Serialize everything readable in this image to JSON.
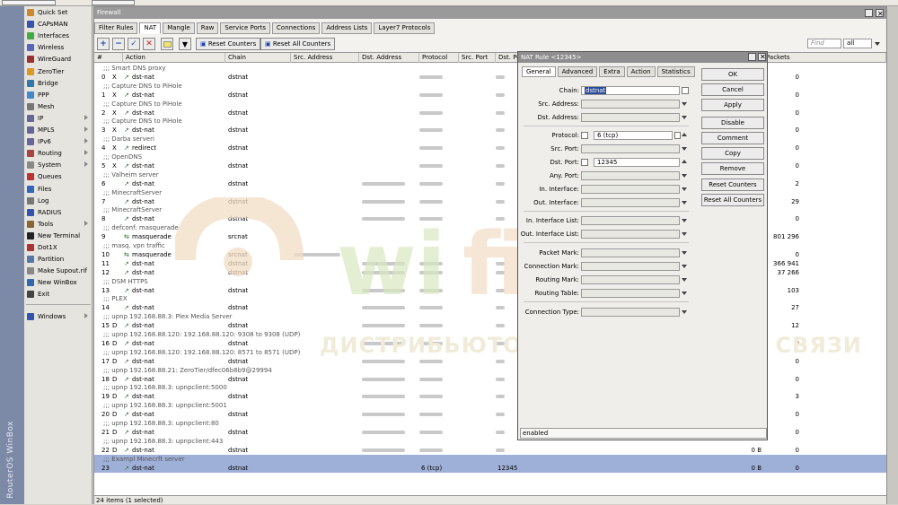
{
  "app": {
    "title": "Firewall",
    "brand_vertical": "RouterOS WinBox"
  },
  "colors": {
    "accent": "#2244aa",
    "selected_row": "#9fb0d8",
    "watermark_orange": "#f0d9c0",
    "watermark_green": "#cfe3b2"
  },
  "sidebar": {
    "items": [
      {
        "label": "Quick Set",
        "icon": "quickset-icon",
        "color": "#cc8833",
        "arrow": false
      },
      {
        "label": "CAPsMAN",
        "icon": "capsman-icon",
        "color": "#3355aa",
        "arrow": false
      },
      {
        "label": "Interfaces",
        "icon": "interfaces-icon",
        "color": "#44aa44",
        "arrow": false
      },
      {
        "label": "Wireless",
        "icon": "wireless-icon",
        "color": "#5566bb",
        "arrow": false
      },
      {
        "label": "WireGuard",
        "icon": "wireguard-icon",
        "color": "#993333",
        "arrow": false
      },
      {
        "label": "ZeroTier",
        "icon": "zerotier-icon",
        "color": "#dd9922",
        "arrow": false
      },
      {
        "label": "Bridge",
        "icon": "bridge-icon",
        "color": "#3377aa",
        "arrow": false
      },
      {
        "label": "PPP",
        "icon": "ppp-icon",
        "color": "#4488cc",
        "arrow": false
      },
      {
        "label": "Mesh",
        "icon": "mesh-icon",
        "color": "#777777",
        "arrow": false
      },
      {
        "label": "IP",
        "icon": "ip-icon",
        "color": "#666699",
        "arrow": true
      },
      {
        "label": "MPLS",
        "icon": "mpls-icon",
        "color": "#666699",
        "arrow": true
      },
      {
        "label": "IPv6",
        "icon": "ipv6-icon",
        "color": "#666699",
        "arrow": true
      },
      {
        "label": "Routing",
        "icon": "routing-icon",
        "color": "#aa4444",
        "arrow": true
      },
      {
        "label": "System",
        "icon": "system-icon",
        "color": "#888888",
        "arrow": true
      },
      {
        "label": "Queues",
        "icon": "queues-icon",
        "color": "#bb3333",
        "arrow": false
      },
      {
        "label": "Files",
        "icon": "files-icon",
        "color": "#3366bb",
        "arrow": false
      },
      {
        "label": "Log",
        "icon": "log-icon",
        "color": "#777777",
        "arrow": false
      },
      {
        "label": "RADIUS",
        "icon": "radius-icon",
        "color": "#3355aa",
        "arrow": false
      },
      {
        "label": "Tools",
        "icon": "tools-icon",
        "color": "#886633",
        "arrow": true
      },
      {
        "label": "New Terminal",
        "icon": "terminal-icon",
        "color": "#222222",
        "arrow": false
      },
      {
        "label": "Dot1X",
        "icon": "dot1x-icon",
        "color": "#aa3333",
        "arrow": false
      },
      {
        "label": "Partition",
        "icon": "partition-icon",
        "color": "#5577aa",
        "arrow": false
      },
      {
        "label": "Make Supout.rif",
        "icon": "supout-icon",
        "color": "#888888",
        "arrow": false
      },
      {
        "label": "New WinBox",
        "icon": "winbox-icon",
        "color": "#3366aa",
        "arrow": false
      },
      {
        "label": "Exit",
        "icon": "exit-icon",
        "color": "#444444",
        "arrow": false
      },
      {
        "label": "Windows",
        "icon": "windows-icon",
        "color": "#3355aa",
        "arrow": true
      }
    ]
  },
  "tabs": [
    "Filter Rules",
    "NAT",
    "Mangle",
    "Raw",
    "Service Ports",
    "Connections",
    "Address Lists",
    "Layer7 Protocols"
  ],
  "active_tab": 1,
  "toolbar": {
    "reset_counters": "Reset Counters",
    "reset_all_counters": "Reset All Counters",
    "find_placeholder": "Find",
    "filter_value": "all"
  },
  "columns": [
    "#",
    "Action",
    "Chain",
    "Src. Address",
    "Dst. Address",
    "Protocol",
    "Src. Port",
    "Dst. Po",
    "",
    "Packets"
  ],
  "rows": [
    {
      "k": "c",
      "t": ";;; Smart DNS proxy"
    },
    {
      "k": "r",
      "n": "0",
      "f": "X",
      "a": "dst-nat",
      "ch": "dstnat",
      "d": 1,
      "p": "0"
    },
    {
      "k": "c",
      "t": ";;; Capture DNS to PiHole"
    },
    {
      "k": "r",
      "n": "1",
      "f": "X",
      "a": "dst-nat",
      "ch": "dstnat",
      "d": 1,
      "p": "0"
    },
    {
      "k": "c",
      "t": ";;; Capture DNS to PiHole"
    },
    {
      "k": "r",
      "n": "2",
      "f": "X",
      "a": "dst-nat",
      "ch": "dstnat",
      "d": 1,
      "p": "0"
    },
    {
      "k": "c",
      "t": ";;; Capture DNS to PiHole"
    },
    {
      "k": "r",
      "n": "3",
      "f": "X",
      "a": "dst-nat",
      "ch": "dstnat",
      "d": 1,
      "p": "0"
    },
    {
      "k": "c",
      "t": ";;; Darba serveri"
    },
    {
      "k": "r",
      "n": "4",
      "f": "X",
      "a": "redirect",
      "ch": "dstnat",
      "d": 1,
      "p": "0"
    },
    {
      "k": "c",
      "t": ";;; OpenDNS"
    },
    {
      "k": "r",
      "n": "5",
      "f": "X",
      "a": "dst-nat",
      "ch": "dstnat",
      "d": 1,
      "p": "0"
    },
    {
      "k": "c",
      "t": ";;; Valheim server"
    },
    {
      "k": "r",
      "n": "6",
      "f": "",
      "a": "dst-nat",
      "ch": "dstnat",
      "d": 2,
      "p": "2"
    },
    {
      "k": "c",
      "t": ";;; MinecraftServer"
    },
    {
      "k": "r",
      "n": "7",
      "f": "",
      "a": "dst-nat",
      "ch": "dstnat",
      "d": 2,
      "p": "29"
    },
    {
      "k": "c",
      "t": ";;; MinecraftServer"
    },
    {
      "k": "r",
      "n": "8",
      "f": "",
      "a": "dst-nat",
      "ch": "dstnat",
      "d": 2,
      "p": "0"
    },
    {
      "k": "c",
      "t": ";;; defconf: masquerade"
    },
    {
      "k": "r",
      "n": "9",
      "f": "",
      "a": "masquerade",
      "ch": "srcnat",
      "d": 0,
      "p": "801 296"
    },
    {
      "k": "c",
      "t": ";;; masq. vpn traffic"
    },
    {
      "k": "r",
      "n": "10",
      "f": "",
      "a": "masquerade",
      "ch": "srcnat",
      "d": 3,
      "p": "0"
    },
    {
      "k": "r",
      "n": "11",
      "f": "",
      "a": "dst-nat",
      "ch": "dstnat",
      "d": 2,
      "p": "366 941"
    },
    {
      "k": "r",
      "n": "12",
      "f": "",
      "a": "dst-nat",
      "ch": "dstnat",
      "d": 2,
      "p": "37 266"
    },
    {
      "k": "c",
      "t": ";;; DSM HTTPS"
    },
    {
      "k": "r",
      "n": "13",
      "f": "",
      "a": "dst-nat",
      "ch": "dstnat",
      "d": 2,
      "p": "103"
    },
    {
      "k": "c",
      "t": ";;; PLEX"
    },
    {
      "k": "r",
      "n": "14",
      "f": "",
      "a": "dst-nat",
      "ch": "dstnat",
      "d": 2,
      "p": "27"
    },
    {
      "k": "c",
      "t": ";;; upnp 192.168.88.3: Plex Media Server"
    },
    {
      "k": "r",
      "n": "15",
      "f": "D",
      "a": "dst-nat",
      "ch": "dstnat",
      "d": 2,
      "p": "12"
    },
    {
      "k": "c",
      "t": ";;; upnp 192.168.88.120: 192.168.88.120: 9308 to 9308 (UDP)"
    },
    {
      "k": "r",
      "n": "16",
      "f": "D",
      "a": "dst-nat",
      "ch": "dstnat",
      "d": 2,
      "p": "0"
    },
    {
      "k": "c",
      "t": ";;; upnp 192.168.88.120: 192.168.88.120: 8571 to 8571 (UDP)"
    },
    {
      "k": "r",
      "n": "17",
      "f": "D",
      "a": "dst-nat",
      "ch": "dstnat",
      "d": 2,
      "p": "0"
    },
    {
      "k": "c",
      "t": ";;; upnp 192.168.88.21: ZeroTier/dfec06b8b9@29994"
    },
    {
      "k": "r",
      "n": "18",
      "f": "D",
      "a": "dst-nat",
      "ch": "dstnat",
      "d": 2,
      "p": "0"
    },
    {
      "k": "c",
      "t": ";;; upnp 192.168.88.3: upnpclient:5000"
    },
    {
      "k": "r",
      "n": "19",
      "f": "D",
      "a": "dst-nat",
      "ch": "dstnat",
      "d": 2,
      "p": "3"
    },
    {
      "k": "c",
      "t": ";;; upnp 192.168.88.3: upnpclient:5001"
    },
    {
      "k": "r",
      "n": "20",
      "f": "D",
      "a": "dst-nat",
      "ch": "dstnat",
      "d": 2,
      "p": "0"
    },
    {
      "k": "c",
      "t": ";;; upnp 192.168.88.3: upnpclient:80"
    },
    {
      "k": "r",
      "n": "21",
      "f": "D",
      "a": "dst-nat",
      "ch": "dstnat",
      "d": 2,
      "p": "0"
    },
    {
      "k": "c",
      "t": ";;; upnp 192.168.88.3: upnpclient:443"
    },
    {
      "k": "r",
      "n": "22",
      "f": "D",
      "a": "dst-nat",
      "ch": "dstnat",
      "d": 2,
      "b": "0 B",
      "p": "0"
    },
    {
      "k": "cs",
      "t": ";;; Exampl Minecrft server"
    },
    {
      "k": "rs",
      "n": "23",
      "f": "",
      "a": "dst-nat",
      "ch": "dstnat",
      "d": 0,
      "pr": "6 (tcp)",
      "dp": "12345",
      "b": "0 B",
      "p": "0"
    }
  ],
  "status": "24 items (1 selected)",
  "dialog": {
    "title": "NAT Rule <12345>",
    "tabs": [
      "General",
      "Advanced",
      "Extra",
      "Action",
      "Statistics"
    ],
    "fields": {
      "chain_label": "Chain:",
      "chain_value": "dstnat",
      "src_address_label": "Src. Address:",
      "dst_address_label": "Dst. Address:",
      "protocol_label": "Protocol:",
      "protocol_value": "6 (tcp)",
      "src_port_label": "Src. Port:",
      "dst_port_label": "Dst. Port:",
      "dst_port_value": "12345",
      "any_port_label": "Any. Port:",
      "in_interface_label": "In. Interface:",
      "out_interface_label": "Out. Interface:",
      "in_interface_list_label": "In. Interface List:",
      "out_interface_list_label": "Out. Interface List:",
      "packet_mark_label": "Packet Mark:",
      "connection_mark_label": "Connection Mark:",
      "routing_mark_label": "Routing Mark:",
      "routing_table_label": "Routing Table:",
      "connection_type_label": "Connection Type:"
    },
    "buttons": [
      "OK",
      "Cancel",
      "Apply",
      "Disable",
      "Comment",
      "Copy",
      "Remove",
      "Reset Counters",
      "Reset All Counters"
    ],
    "status": "enabled"
  },
  "watermark": {
    "text": "ДИСТРИБЬЮТОР ОБОРУДОВАНИЯ СВЯЗИ",
    "logo_text": "wifi.ru"
  }
}
